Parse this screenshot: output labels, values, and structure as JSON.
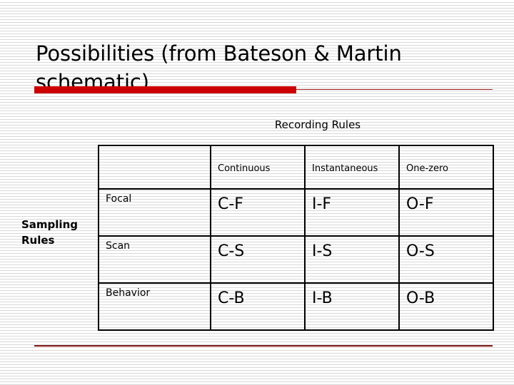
{
  "slide": {
    "title": "Possibilities (from Bateson & Martin schematic)",
    "accent_color": "#CC0000",
    "rule_color": "#7D2020",
    "background_color": "#FFFFFF"
  },
  "matrix": {
    "column_group_label": "Recording Rules",
    "row_group_label": "Sampling\nRules",
    "row_group_label_line1": "Sampling",
    "row_group_label_line2": "Rules",
    "corner_cell": "",
    "column_headers": [
      "Continuous",
      "Instantaneous",
      "One-zero"
    ],
    "row_headers": [
      "Focal",
      "Scan",
      "Behavior"
    ],
    "cells": [
      [
        "C-F",
        "I-F",
        "O-F"
      ],
      [
        "C-S",
        "I-S",
        "O-S"
      ],
      [
        "C-B",
        "I-B",
        "O-B"
      ]
    ]
  }
}
